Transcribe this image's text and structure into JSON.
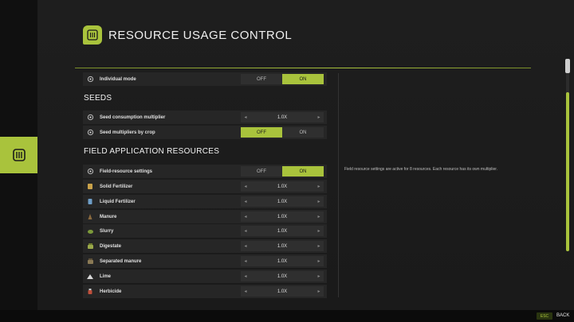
{
  "header": {
    "title": "RESOURCE USAGE CONTROL",
    "icon": "resource-icon"
  },
  "accent": "#a9c33c",
  "individual_mode": {
    "label": "Individual mode",
    "off": "OFF",
    "on": "ON",
    "selected": "ON"
  },
  "seeds": {
    "title": "SEEDS",
    "consumption": {
      "label": "Seed consumption multiplier",
      "value": "1.0X"
    },
    "by_crop": {
      "label": "Seed multipliers by crop",
      "off": "OFF",
      "on": "ON",
      "selected": "OFF"
    }
  },
  "field": {
    "title": "FIELD APPLICATION RESOURCES",
    "settings": {
      "label": "Field-resource settings",
      "off": "OFF",
      "on": "ON",
      "selected": "ON"
    },
    "description": "Field resource settings are active for 8 resources. Each resource has its own multiplier.",
    "items": [
      {
        "label": "Solid Fertilizer",
        "value": "1.0X",
        "icon": "solid-fertilizer-icon"
      },
      {
        "label": "Liquid Fertilizer",
        "value": "1.0X",
        "icon": "liquid-fertilizer-icon"
      },
      {
        "label": "Manure",
        "value": "1.0X",
        "icon": "manure-icon"
      },
      {
        "label": "Slurry",
        "value": "1.0X",
        "icon": "slurry-icon"
      },
      {
        "label": "Digestate",
        "value": "1.0X",
        "icon": "digestate-icon"
      },
      {
        "label": "Separated manure",
        "value": "1.0X",
        "icon": "separated-manure-icon"
      },
      {
        "label": "Lime",
        "value": "1.0X",
        "icon": "lime-icon"
      },
      {
        "label": "Herbicide",
        "value": "1.0X",
        "icon": "herbicide-icon"
      }
    ]
  },
  "footer": {
    "key": "ESC",
    "action": "BACK"
  }
}
